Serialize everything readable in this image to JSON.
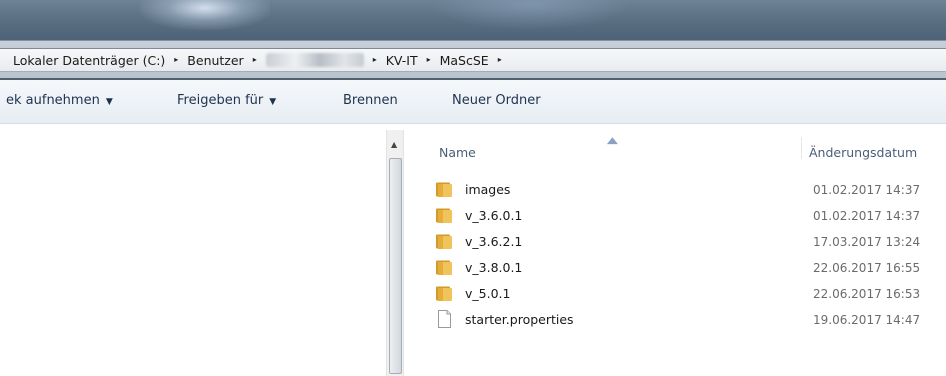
{
  "breadcrumb": {
    "items": [
      "Lokaler Datenträger (C:)",
      "Benutzer",
      "KV-IT",
      "MaScSE"
    ],
    "separator": "▸"
  },
  "toolbar": {
    "library_label": "ek aufnehmen",
    "share_label": "Freigeben für",
    "burn_label": "Brennen",
    "new_folder_label": "Neuer Ordner",
    "caret": "▼"
  },
  "filelist": {
    "columns": {
      "name": "Name",
      "date": "Änderungsdatum"
    },
    "rows": [
      {
        "name": "images",
        "date": "01.02.2017 14:37",
        "type": "folder"
      },
      {
        "name": "v_3.6.0.1",
        "date": "01.02.2017 14:37",
        "type": "folder"
      },
      {
        "name": "v_3.6.2.1",
        "date": "17.03.2017 13:24",
        "type": "folder"
      },
      {
        "name": "v_3.8.0.1",
        "date": "22.06.2017 16:55",
        "type": "folder"
      },
      {
        "name": "v_5.0.1",
        "date": "22.06.2017 16:53",
        "type": "folder"
      },
      {
        "name": "starter.properties",
        "date": "19.06.2017 14:47",
        "type": "file"
      }
    ]
  },
  "icons": {
    "folder": "folder-icon",
    "file": "file-icon",
    "sort": "sort-ascending-icon",
    "scroll_up": "scroll-up-arrow-icon"
  },
  "colors": {
    "toolbar_text": "#1e3250",
    "column_header": "#4a5e77",
    "folder": "#e8b84a"
  }
}
